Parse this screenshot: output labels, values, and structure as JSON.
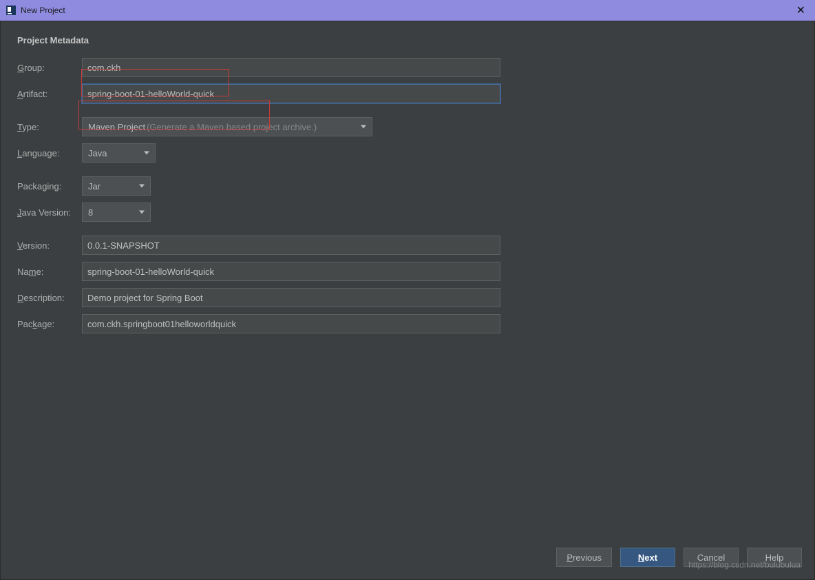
{
  "titlebar": {
    "title": "New Project"
  },
  "section": {
    "heading": "Project Metadata"
  },
  "labels": {
    "group": "roup:",
    "group_u": "G",
    "artifact": "rtifact:",
    "artifact_u": "A",
    "type": "ype:",
    "type_u": "T",
    "language": "anguage:",
    "language_u": "L",
    "packaging": "Packaging:",
    "java_version": "ava Version:",
    "java_version_u": "J",
    "version": "ersion:",
    "version_u": "V",
    "name_pre": "Na",
    "name_u": "m",
    "name_post": "e:",
    "description": "escription:",
    "description_u": "D",
    "package_pre": "Pac",
    "package_u": "k",
    "package_post": "age:"
  },
  "values": {
    "group": "com.ckh",
    "artifact": "spring-boot-01-helloWorld-quick",
    "type": "Maven Project",
    "type_hint": " (Generate a Maven based project archive.)",
    "language": "Java",
    "packaging": "Jar",
    "java_version": "8",
    "version": "0.0.1-SNAPSHOT",
    "name": "spring-boot-01-helloWorld-quick",
    "description": "Demo project for Spring Boot",
    "package": "com.ckh.springboot01helloworldquick"
  },
  "buttons": {
    "previous_u": "P",
    "previous": "revious",
    "next_u": "N",
    "next": "ext",
    "cancel": "Cancel",
    "help": "Help"
  },
  "watermark": "https://blog.csdn.net/bulubulua"
}
